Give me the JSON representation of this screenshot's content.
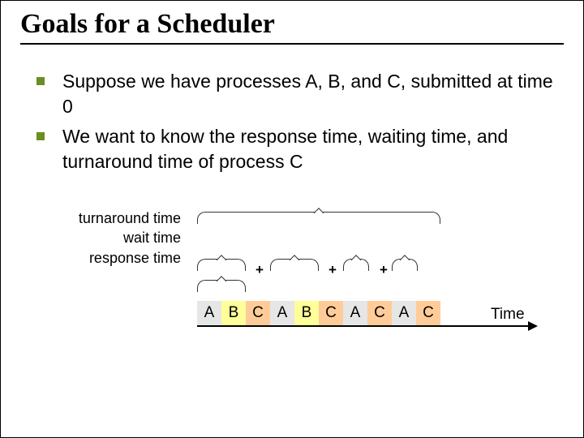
{
  "title": "Goals for a Scheduler",
  "bullets": [
    "Suppose we have processes A, B, and C, submitted at time 0",
    "We want to know the response time, waiting time, and turnaround time of process C"
  ],
  "labels": {
    "turnaround": "turnaround time",
    "wait": "wait time",
    "response": "response time"
  },
  "schedule": [
    "A",
    "B",
    "C",
    "A",
    "B",
    "C",
    "A",
    "C",
    "A",
    "C"
  ],
  "time_axis": "Time",
  "plus": "+"
}
